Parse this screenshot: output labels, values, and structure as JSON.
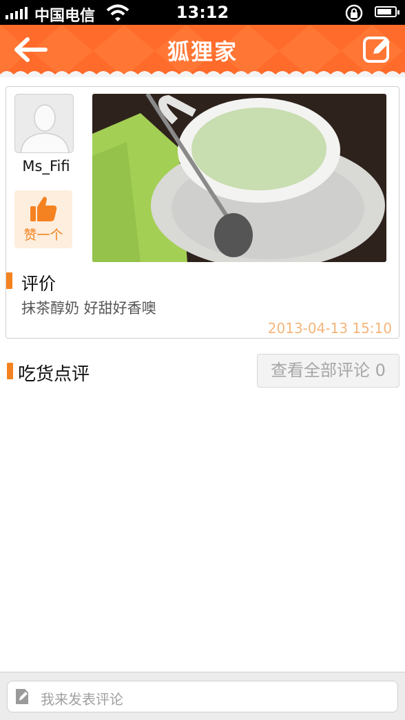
{
  "status_bar": {
    "carrier": "中国电信",
    "time": "13:12"
  },
  "nav": {
    "title": "狐狸家",
    "back_icon": "back-arrow-icon",
    "compose_icon": "compose-icon"
  },
  "post": {
    "username": "Ms_Fifi",
    "like_label": "赞一个",
    "review_heading": "评价",
    "review_text": "抹茶醇奶 好甜好香噢",
    "timestamp": "2013-04-13 15:10"
  },
  "comments": {
    "heading": "吃货点评",
    "view_all_label": "查看全部评论 0"
  },
  "comment_input": {
    "placeholder": "我来发表评论"
  },
  "colors": {
    "accent": "#f58220",
    "nav_bg": "#ff6b2a",
    "timestamp": "#f5b57a"
  }
}
